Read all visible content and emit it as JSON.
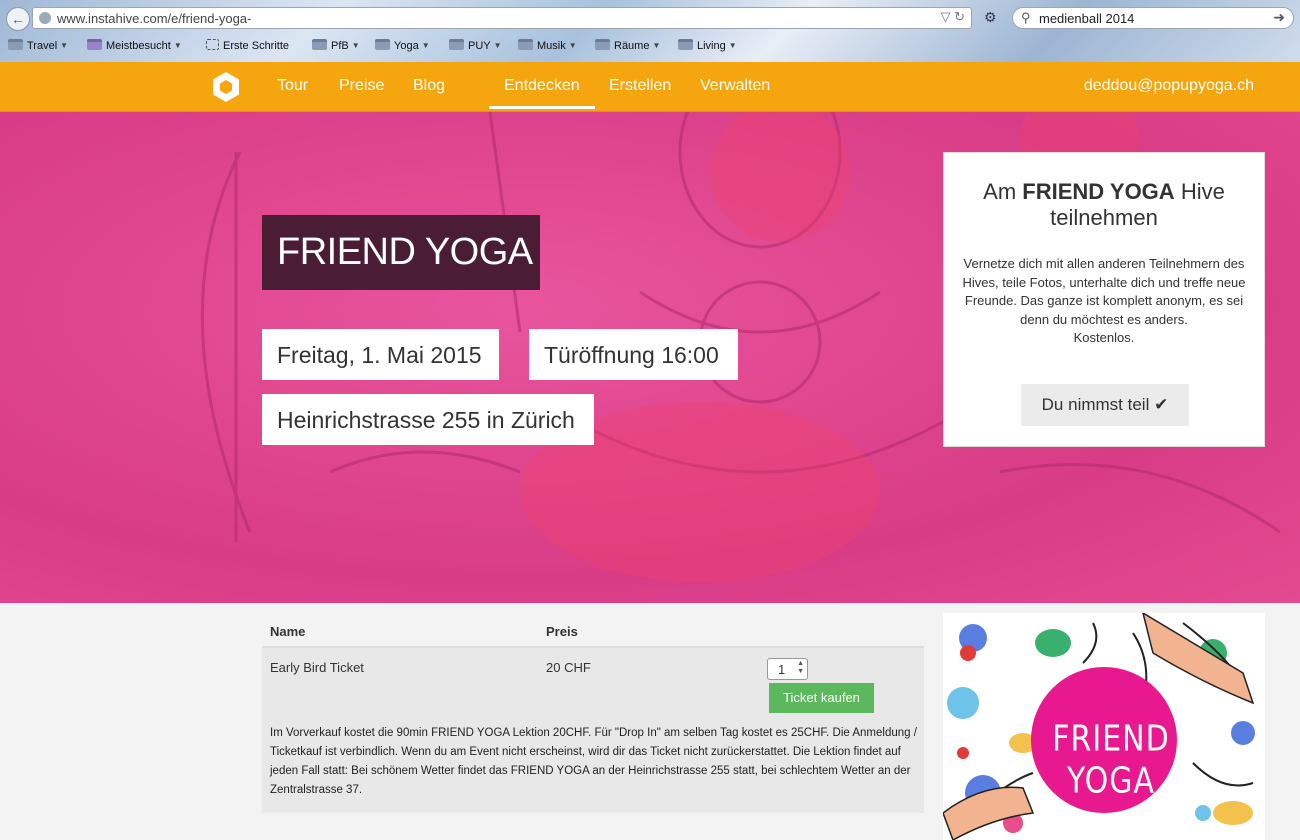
{
  "browser": {
    "url": "www.instahive.com/e/friend-yoga-",
    "search_query": "medienball 2014",
    "bookmarks": [
      "Travel",
      "Meistbesucht",
      "Erste Schritte",
      "PfB",
      "Yoga",
      "PUY",
      "Musik",
      "Räume",
      "Living"
    ]
  },
  "site_nav": {
    "links": [
      "Tour",
      "Preise",
      "Blog",
      "Entdecken",
      "Erstellen",
      "Verwalten"
    ],
    "active": "Entdecken",
    "user_email": "deddou@popupyoga.ch"
  },
  "event": {
    "title": "FRIEND YOGA",
    "date": "Freitag, 1. Mai 2015",
    "door_time": "Türöffnung 16:00",
    "location": "Heinrichstrasse 255 in Zürich"
  },
  "join_card": {
    "title_prefix": "Am",
    "title_bold": "FRIEND YOGA",
    "title_suffix": "Hive teilnehmen",
    "text": "Vernetze dich mit allen anderen Teilnehmern des Hives, teile Fotos, unterhalte dich und treffe neue Freunde. Das ganze ist komplett anonym, es sei denn du möchtest es anders.",
    "free_label": "Kostenlos.",
    "button_label": "Du nimmst teil"
  },
  "tickets": {
    "headers": [
      "Name",
      "Preis"
    ],
    "rows": [
      {
        "name": "Early Bird Ticket",
        "price": "20 CHF",
        "quantity": "1",
        "buy_label": "Ticket kaufen",
        "description": "Im Vorverkauf kostet die 90min FRIEND YOGA Lektion 20CHF. Für \"Drop In\" am selben Tag kostet es 25CHF. Die Anmeldung / Ticketkauf ist verbindlich. Wenn du am Event nicht erscheinst, wird dir das Ticket nicht zurückerstattet. Die Lektion findet auf jeden Fall statt: Bei schönem Wetter findet das FRIEND YOGA an der Heinrichstrasse 255 statt, bei schlechtem Wetter an der Zentralstrasse 37."
      }
    ]
  },
  "poster": {
    "title": "FRIEND YOGA"
  },
  "colors": {
    "nav": "#f5a50d",
    "hero_pink": "#e0478f",
    "title_bg": "#4a1d34",
    "buy_green": "#5cb85c"
  }
}
